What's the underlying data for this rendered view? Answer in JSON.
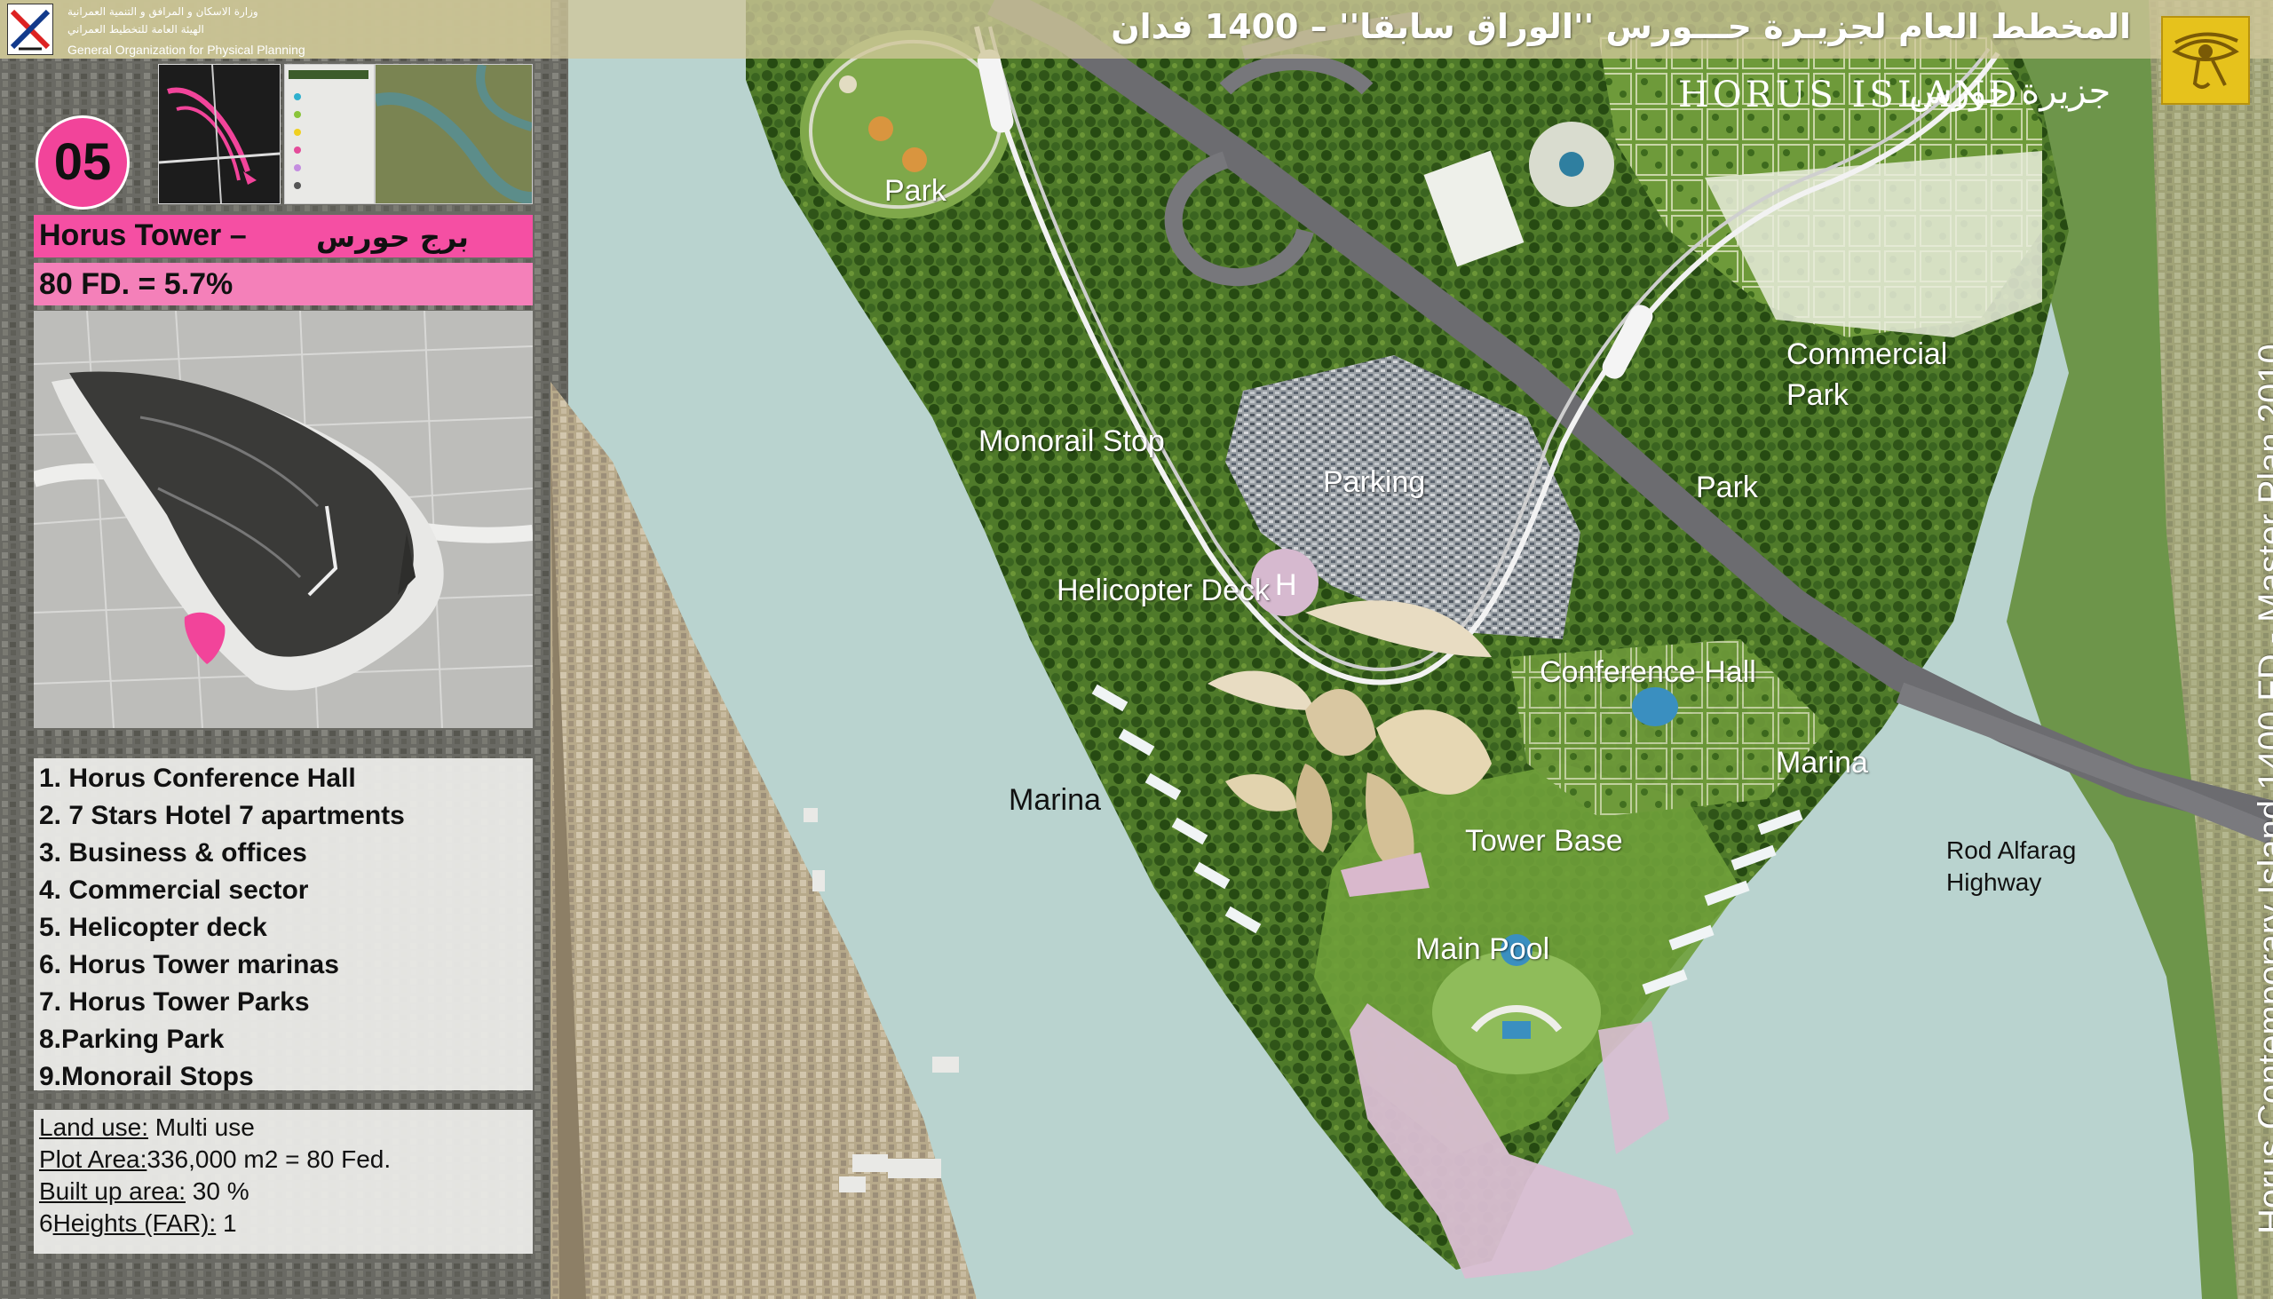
{
  "header": {
    "org_arabic_1": "وزارة الاسكان و المرافق و التنمية العمرانية",
    "org_arabic_2": "الهيئة العامة للتخطيط العمراني",
    "org_english": "General Organization for Physical Planning",
    "title_arabic": "المخطط العام لجزيـرة حـــورس ''الوراق سابقا'' – 1400 فدان",
    "island_logo_en": "HORUS ISLAND",
    "island_logo_ar": "جزيرة حورس"
  },
  "sidebar": {
    "badge": "05",
    "project_title_en": "Horus Tower –",
    "project_title_ar": "برج حورس",
    "area": "80 FD. = 5.7%",
    "components": [
      "1. Horus Conference Hall",
      "2. 7 Stars Hotel 7 apartments",
      "3. Business & offices",
      "4. Commercial sector",
      "5. Helicopter deck",
      "6. Horus Tower marinas",
      "7. Horus Tower Parks",
      "8.Parking Park",
      "9.Monorail Stops"
    ],
    "info": {
      "land_use_label": "Land use:",
      "land_use_value": " Multi use",
      "plot_area_label": "Plot Area:",
      "plot_area_value": "336,000 m2 = 80 Fed.",
      "built_up_label": "Built up area:",
      "built_up_value": " 30 %",
      "heights_prefix": "6",
      "heights_label": "Heights (FAR):",
      "heights_value": " 1"
    }
  },
  "map_labels": {
    "park_top": "Park",
    "monorail_stop": "Monorail Stop",
    "parking": "Parking",
    "helicopter_deck": "Helicopter Deck",
    "conference_hall": "Conference Hall",
    "marina_left": "Marina",
    "marina_right": "Marina",
    "tower_base": "Tower Base",
    "main_pool": "Main Pool",
    "commercial_park_1": "Commercial",
    "commercial_park_2": "Park",
    "park_right": "Park",
    "highway_1": "Rod Alfarag",
    "highway_2": "Highway"
  },
  "vertical_title": "Horus Contemporary Island 1400 FD - Master Plan 2010",
  "colors": {
    "accent_pink": "#f2449a",
    "title_bar_pink": "#f54fa3",
    "water": "#b9d3cf",
    "vegetation": "#3e6b23",
    "header_band": "#c9c294",
    "logo_gold": "#e6c21c"
  },
  "icons": {
    "org_logo": "gopp-logo-icon",
    "horus_logo": "eye-of-horus-icon"
  }
}
